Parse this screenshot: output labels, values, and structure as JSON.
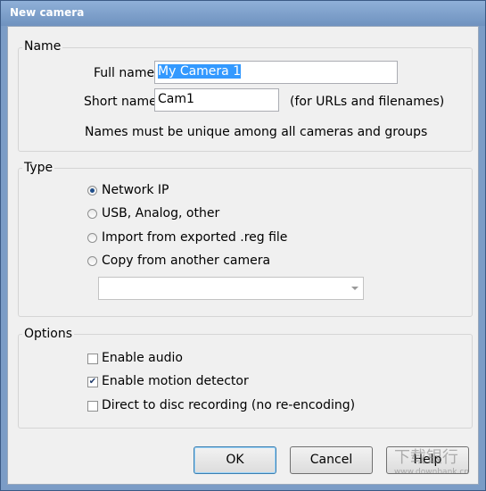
{
  "window": {
    "title": "New camera"
  },
  "name_group": {
    "legend": "Name",
    "full_name_label": "Full name",
    "full_name_value": "My Camera 1",
    "short_name_label": "Short name",
    "short_name_value": "Cam1",
    "short_name_hint": "(for URLs and filenames)",
    "unique_note": "Names must be unique among all cameras and groups"
  },
  "type_group": {
    "legend": "Type",
    "options": [
      {
        "label": "Network IP",
        "selected": true
      },
      {
        "label": "USB, Analog, other",
        "selected": false
      },
      {
        "label": "Import from exported .reg file",
        "selected": false
      },
      {
        "label": "Copy from another camera",
        "selected": false
      }
    ],
    "copy_camera_selected": ""
  },
  "options_group": {
    "legend": "Options",
    "checkboxes": [
      {
        "label": "Enable audio",
        "checked": false
      },
      {
        "label": "Enable motion detector",
        "checked": true
      },
      {
        "label": "Direct to disc recording (no re-encoding)",
        "checked": false
      }
    ]
  },
  "buttons": {
    "ok": "OK",
    "cancel": "Cancel",
    "help": "Help"
  },
  "watermark": {
    "text": "下载银行",
    "url": "www.downbank.cn"
  }
}
